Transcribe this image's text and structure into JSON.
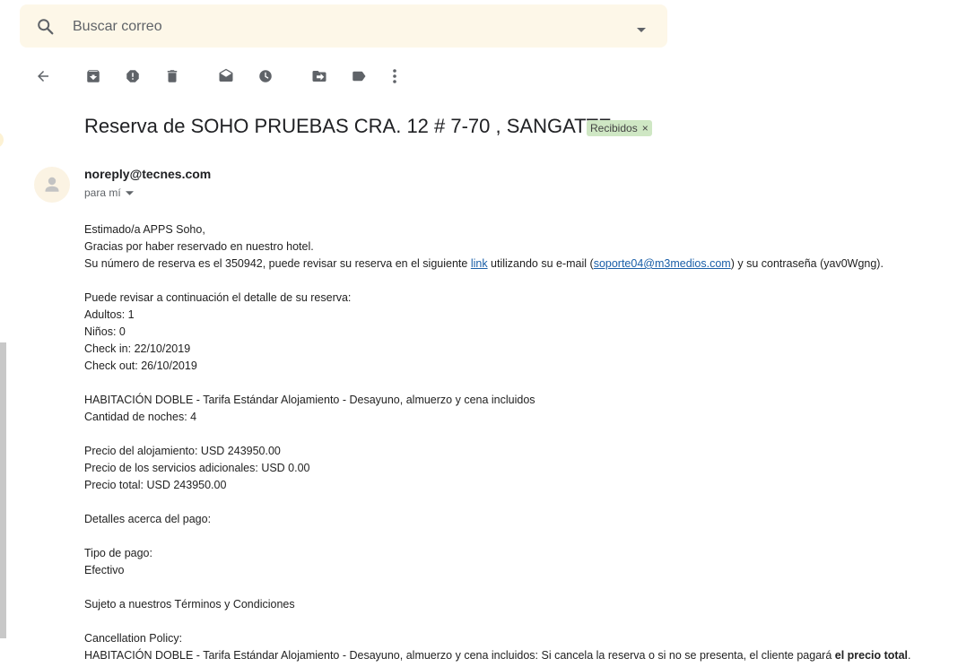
{
  "search": {
    "placeholder": "Buscar correo",
    "value": ""
  },
  "toolbar": {
    "icons": [
      "back-arrow-icon",
      "archive-icon",
      "report-spam-icon",
      "delete-icon",
      "mark-unread-icon",
      "snooze-icon",
      "move-to-icon",
      "label-icon",
      "more-vert-icon"
    ]
  },
  "message": {
    "subject": "Reserva de SOHO PRUEBAS CRA. 12 # 7-70 , SANGATTE",
    "label": "Recibidos",
    "label_close": "×",
    "sender": "noreply@tecnes.com",
    "recipient": "para mí"
  },
  "body": {
    "greeting": "Estimado/a APPS Soho,",
    "thanks": "Gracias por haber reservado en nuestro hotel.",
    "reservation_prefix": "Su número de reserva es el 350942, puede revisar su reserva en el siguiente ",
    "reservation_link": "link",
    "reservation_mid": " utilizando su e-mail (",
    "email_link": "soporte04@m3medios.com",
    "reservation_suffix": ") y su contraseña (yav0Wgng).",
    "detail_intro": "Puede revisar a continuación el detalle de su reserva:",
    "adults": "Adultos: 1",
    "children": "Niños: 0",
    "checkin": "Check in: 22/10/2019",
    "checkout": "Check out: 26/10/2019",
    "room": "HABITACIÓN DOBLE - Tarifa Estándar Alojamiento - Desayuno, almuerzo y cena incluidos",
    "nights": "Cantidad de noches: 4",
    "price_lodging": "Precio del alojamiento: USD 243950.00",
    "price_services": "Precio de los servicios adicionales: USD 0.00",
    "price_total": "Precio total: USD 243950.00",
    "payment_details": "Detalles acerca del pago:",
    "payment_type_label": "Tipo de pago:",
    "payment_type": "Efectivo",
    "terms": "Sujeto a nuestros Términos y Condiciones",
    "cancellation_title": "Cancellation Policy:",
    "cancellation_text": "HABITACIÓN DOBLE - Tarifa Estándar Alojamiento - Desayuno, almuerzo y cena incluidos: Si cancela la reserva o si no se presenta, el cliente pagará ",
    "cancellation_bold": "el precio total",
    "cancellation_end": "."
  },
  "colors": {
    "search_bg": "#fdf7e8",
    "label_bg": "#cfe7c4",
    "link": "#1a5fa8",
    "icon": "#5f6368"
  }
}
